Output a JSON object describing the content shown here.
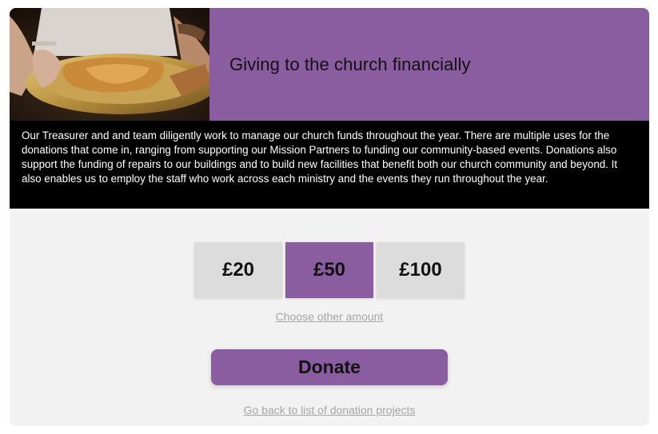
{
  "hero": {
    "title": "Giving to the church financially",
    "image_icon": "collection-plate-photo",
    "accent_color": "#8a5ca0"
  },
  "description": "Our Treasurer and and team diligently work to manage our church funds throughout the year. There are multiple uses for the donations that come in, ranging from supporting our Mission Partners to funding our community-based events. Donations also support the funding of repairs to our buildings and to build new facilities that benefit both our church community and beyond. It also enables us to employ the staff who work across each ministry and the events they run throughout the year.",
  "amounts": {
    "options": [
      "£20",
      "£50",
      "£100"
    ],
    "selected": "£50"
  },
  "other_amount_label": "Choose other amount",
  "donate_label": "Donate",
  "back_label": "Go back to list of donation projects"
}
